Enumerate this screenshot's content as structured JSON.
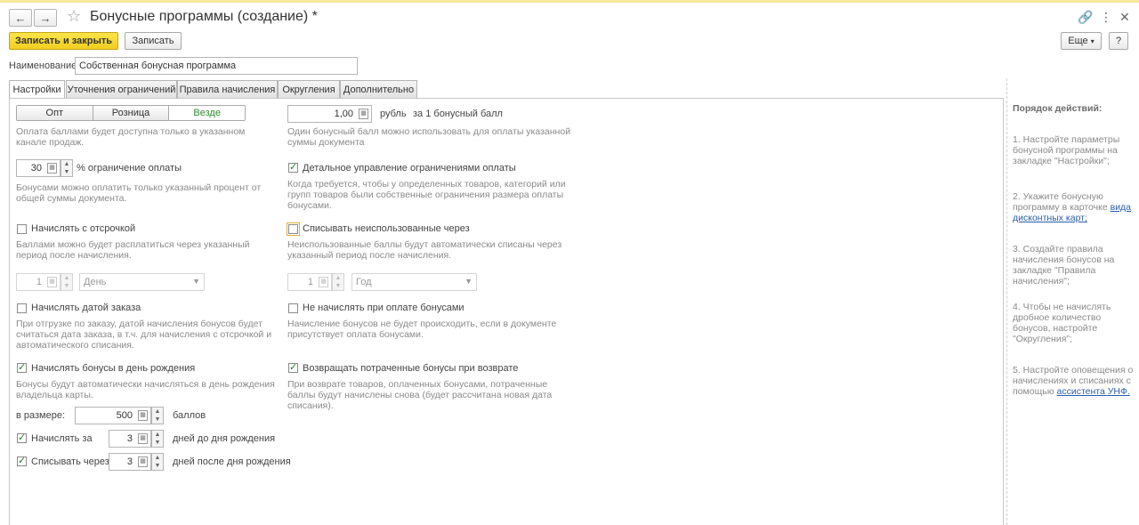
{
  "window": {
    "title": "Бонусные программы (создание) *"
  },
  "toolbar": {
    "save_close": "Записать и закрыть",
    "save": "Записать",
    "more": "Еще",
    "help": "?"
  },
  "name_field": {
    "label": "Наименование:",
    "value": "Собственная бонусная программа"
  },
  "tabs": [
    "Настройки",
    "Уточнения ограничений",
    "Правила начисления",
    "Округления",
    "Дополнительно"
  ],
  "settings": {
    "channel": {
      "options": [
        "Опт",
        "Розница",
        "Везде"
      ],
      "selected": "Везде",
      "hint": "Оплата баллами будет доступна только в указанном канале продаж."
    },
    "rate": {
      "value": "1,00",
      "unit": "рубль",
      "suffix": "за 1 бонусный балл",
      "hint": "Один бонусный балл можно использовать для оплаты указанной суммы документа"
    },
    "limit": {
      "value": "30",
      "label": "% ограничение оплаты",
      "hint": "Бонусами можно оплатить только указанный процент от общей суммы документа."
    },
    "detailed_limits": {
      "label": "Детальное управление ограничениями оплаты",
      "checked": true,
      "hint": "Когда требуется, чтобы у определенных товаров, категорий или групп товаров были собственные ограничения размера оплаты бонусами."
    },
    "delayed": {
      "label": "Начислять с отсрочкой",
      "checked": false,
      "hint": "Баллами можно будет расплатиться через указанный период после начисления.",
      "count": "1",
      "period": "День"
    },
    "write_off": {
      "label": "Списывать неиспользованные через",
      "checked": false,
      "hint": "Неиспользованные баллы будут автоматически списаны через указанный период после начисления.",
      "count": "1",
      "period": "Год"
    },
    "order_date": {
      "label": "Начислять датой заказа",
      "checked": false,
      "hint": "При отгрузке по заказу, датой начисления бонусов будет считаться дата заказа, в т.ч. для начисления с отсрочкой и автоматического списания."
    },
    "no_accrual_on_bonus_pay": {
      "label": "Не начислять при оплате бонусами",
      "checked": false,
      "hint": "Начисление бонусов не будет происходить, если в документе присутствует оплата бонусами."
    },
    "birthday": {
      "label": "Начислять бонусы в день рождения",
      "checked": true,
      "hint": "Бонусы будут автоматически начисляться в день рождения владельца карты.",
      "amount_label": "в размере:",
      "amount": "500",
      "amount_unit": "баллов",
      "before_label": "Начислять за",
      "before_checked": true,
      "before_value": "3",
      "before_unit": "дней до дня рождения",
      "after_label": "Списывать через",
      "after_checked": true,
      "after_value": "3",
      "after_unit": "дней после дня рождения"
    },
    "return_bonuses": {
      "label": "Возвращать потраченные бонусы при возврате",
      "checked": true,
      "hint": "При возврате товаров, оплаченных бонусами, потраченные баллы будут начислены снова (будет рассчитана новая дата списания)."
    }
  },
  "sidebar": {
    "heading": "Порядок действий:",
    "step1": "1. Настройте параметры бонусной программы на закладке \"Настройки\";",
    "step2_text": "2. Укажите бонусную программу в карточке",
    "step2_link": "вида дисконтных карт;",
    "step3": "3. Создайте правила начисления бонусов на закладке \"Правила начисления\";",
    "step4": "4. Чтобы не начислять дробное количество бонусов, настройте \"Округления\";",
    "step5_text": "5. Настройте оповещения о начислениях и списаниях с помощью",
    "step5_link": "ассистента УНФ."
  }
}
